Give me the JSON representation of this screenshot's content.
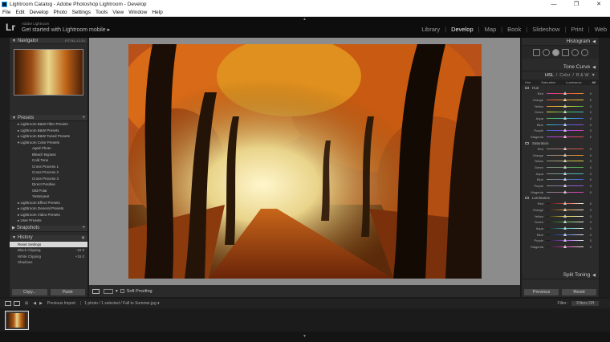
{
  "window": {
    "title": "Lightroom Catalog - Adobe Photoshop Lightroom - Develop",
    "controls": [
      "—",
      "❐",
      "✕"
    ]
  },
  "menu": [
    "File",
    "Edit",
    "Develop",
    "Photo",
    "Settings",
    "Tools",
    "View",
    "Window",
    "Help"
  ],
  "identity": {
    "logo": "Lr",
    "small": "Adobe Lightroom",
    "big": "Get started with Lightroom mobile ▸"
  },
  "modules": [
    "Library",
    "Develop",
    "Map",
    "Book",
    "Slideshow",
    "Print",
    "Web"
  ],
  "active_module": "Develop",
  "navigator": {
    "title": "Navigator",
    "options": "FIT  FILL  1:1  3:1"
  },
  "presets": {
    "title": "Presets",
    "items": [
      "▸ Lightroom B&W Filter Presets",
      "▸ Lightroom B&W Presets",
      "▸ Lightroom B&W Toned Presets",
      "▾ Lightroom Color Presets",
      "Aged Photo",
      "Bleach Bypass",
      "Cold Tone",
      "Cross Process 1",
      "Cross Process 2",
      "Cross Process 3",
      "Direct Positive",
      "Old Polar",
      "Yesteryear",
      "▸ Lightroom Effect Presets",
      "▸ Lightroom General Presets",
      "▸ Lightroom Video Presets",
      "▸ User Presets"
    ]
  },
  "snapshots": {
    "title": "Snapshots"
  },
  "history": {
    "title": "History",
    "items": [
      {
        "label": "Reset Settings",
        "a": "",
        "b": ""
      },
      {
        "label": "Black Clipping",
        "a": "-15",
        "b": "0"
      },
      {
        "label": "White Clipping",
        "a": "+15",
        "b": "0"
      },
      {
        "label": "Shadows",
        "a": "",
        "b": ""
      }
    ]
  },
  "left_buttons": {
    "copy": "Copy...",
    "paste": "Paste"
  },
  "toolbar": {
    "soft_proofing": "Soft Proofing"
  },
  "right": {
    "histogram": "Histogram",
    "tone_curve": "Tone Curve",
    "hsl": {
      "hsl": "HSL",
      "color": "Color",
      "bw": "B & W",
      "sep": "/"
    },
    "subtabs": [
      "Hue",
      "Saturation",
      "Luminance",
      "All"
    ],
    "groups": [
      "Hue",
      "Saturation",
      "Luminance"
    ],
    "colors": [
      "Red",
      "Orange",
      "Yellow",
      "Green",
      "Aqua",
      "Blue",
      "Purple",
      "Magenta"
    ],
    "zero": "0",
    "split_toning": "Split Toning",
    "previous": "Previous",
    "reset": "Reset"
  },
  "filmstrip": {
    "source": "Previous Import",
    "info": "1 photo / 1 selected / Fall to Summer.jpg ▾",
    "filter_label": "Filter :",
    "filter_value": "Filters Off"
  },
  "colors": {
    "hue_track": [
      "#e24a3a",
      "#f0902a",
      "#e8d83a",
      "#4ab84a",
      "#3ac0c8",
      "#3a6ae0",
      "#9a4ae0",
      "#e03ab0"
    ]
  }
}
